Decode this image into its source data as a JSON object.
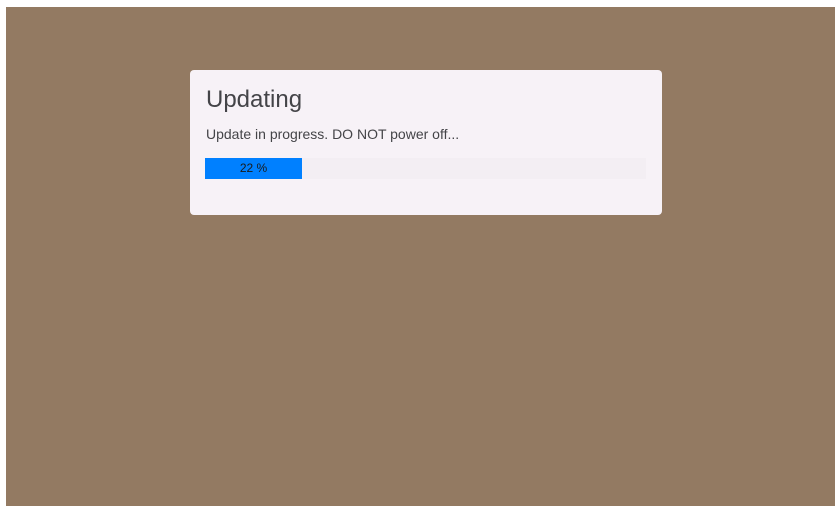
{
  "dialog": {
    "title": "Updating",
    "message": "Update in progress. DO NOT power off...",
    "progress": {
      "value": 22,
      "label": "22 %"
    }
  },
  "colors": {
    "background": "#937a62",
    "dialog": "#f7f2f7",
    "progress_fill": "#0080ff"
  }
}
